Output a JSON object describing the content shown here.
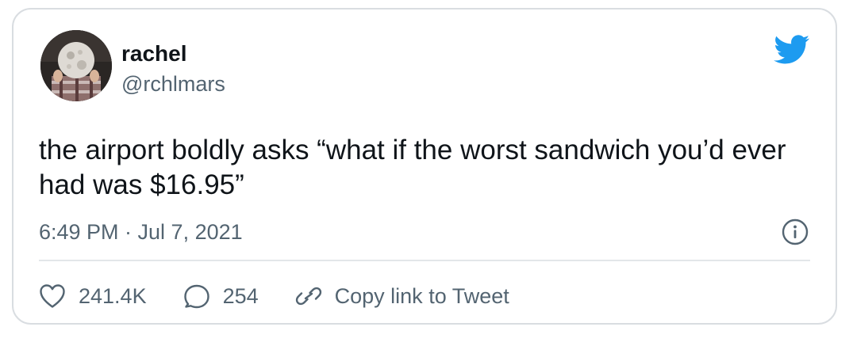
{
  "author": {
    "name": "rachel",
    "handle": "@rchlmars"
  },
  "tweet": {
    "text": "the airport boldly asks “what if the worst sandwich you’d ever had was $16.95”",
    "timestamp": "6:49 PM · Jul 7, 2021"
  },
  "actions": {
    "likes": "241.4K",
    "replies": "254",
    "copy_link": "Copy link to Tweet"
  },
  "icons": {
    "brand": "twitter-bird-icon",
    "info": "info-icon",
    "like": "heart-icon",
    "reply": "speech-bubble-icon",
    "link": "link-icon"
  },
  "colors": {
    "brand_blue": "#1d9bf0",
    "text_primary": "#0f1419",
    "text_secondary": "#536471",
    "border": "#d9dde1"
  }
}
